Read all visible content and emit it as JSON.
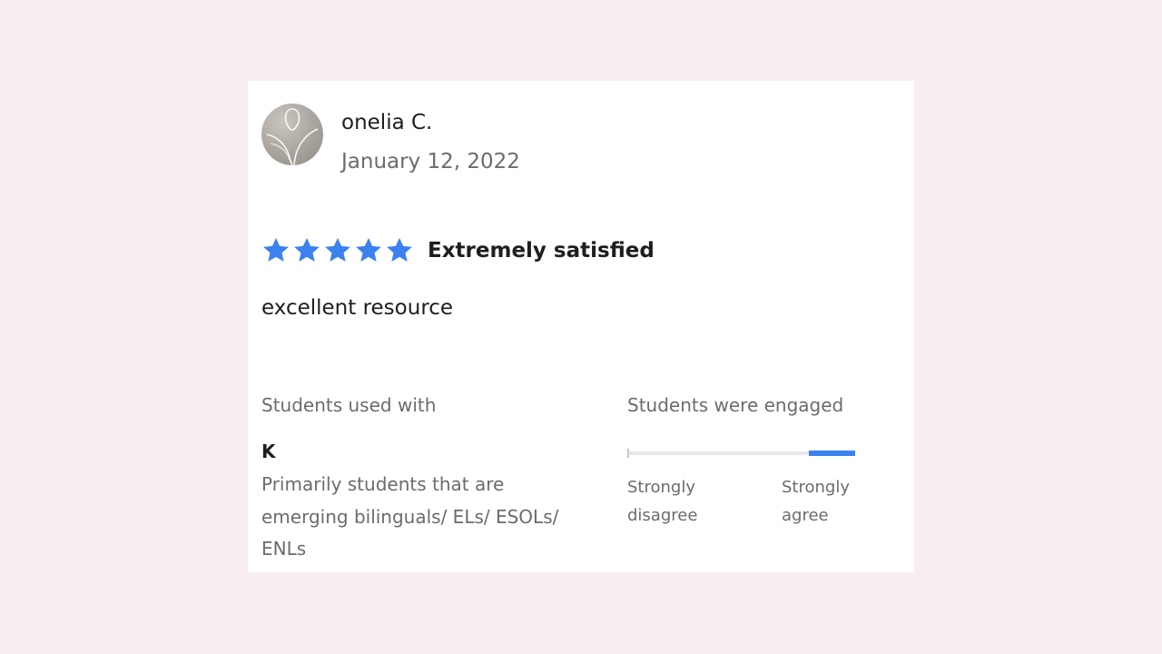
{
  "review": {
    "reviewer_name": "onelia C.",
    "date": "January 12, 2022",
    "rating": 5,
    "rating_max": 5,
    "rating_label": "Extremely satisfied",
    "body": "excellent resource",
    "star_color": "#3b82f0"
  },
  "students_used_with": {
    "heading": "Students used with",
    "grade": "K",
    "description": "Primarily students that are emerging bilinguals/ ELs/ ESOLs/ ENLs"
  },
  "engagement": {
    "heading": "Students were engaged",
    "min_label": "Strongly disagree",
    "max_label": "Strongly agree",
    "level": 1.0,
    "accent_color": "#3b82f0"
  },
  "icons": {
    "avatar": "reviewer-avatar-icon",
    "star": "star-icon"
  }
}
